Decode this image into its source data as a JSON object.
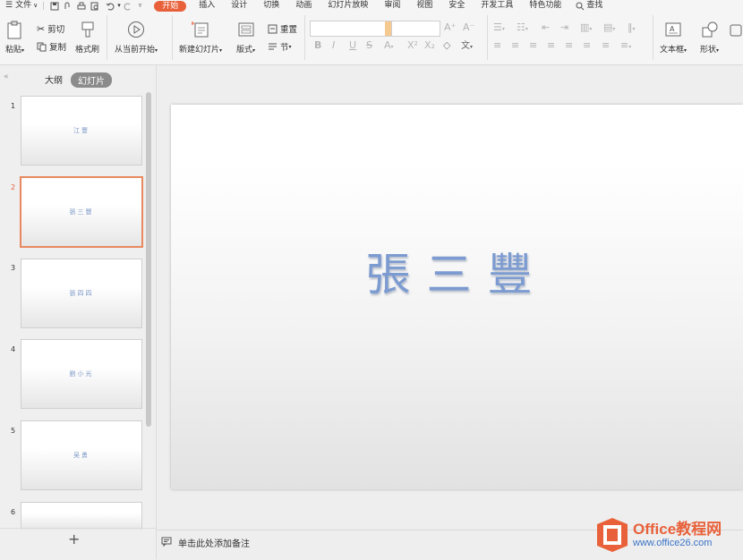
{
  "menubar": {
    "file": "文件",
    "tabs": [
      "开始",
      "插入",
      "设计",
      "切换",
      "动画",
      "幻灯片放映",
      "审阅",
      "视图",
      "安全",
      "开发工具",
      "特色功能"
    ],
    "search": "查找"
  },
  "ribbon": {
    "paste": "粘贴",
    "cut": "剪切",
    "copy": "复制",
    "format_painter": "格式刷",
    "play_from_current": "从当前开始",
    "new_slide": "新建幻灯片",
    "layout": "版式",
    "reset": "重置",
    "section": "节",
    "textbox": "文本框",
    "shape": "形状",
    "font_value": "",
    "size_value": ""
  },
  "panel": {
    "outline_tab": "大纲",
    "slides_tab": "幻灯片",
    "add_slide": "+",
    "slides": [
      {
        "num": "1",
        "title": "江豐"
      },
      {
        "num": "2",
        "title": "張三豐"
      },
      {
        "num": "3",
        "title": "張四四"
      },
      {
        "num": "4",
        "title": "劉小光"
      },
      {
        "num": "5",
        "title": "吴勇"
      },
      {
        "num": "6",
        "title": ""
      }
    ]
  },
  "slide": {
    "title": "張三豐"
  },
  "notes": {
    "placeholder": "单击此处添加备注"
  },
  "watermark": {
    "brand": "Office教程网",
    "url": "www.office26.com"
  },
  "colors": {
    "accent": "#e8613a",
    "title_text": "#7c9bd0",
    "selected_border": "#e8885f"
  }
}
